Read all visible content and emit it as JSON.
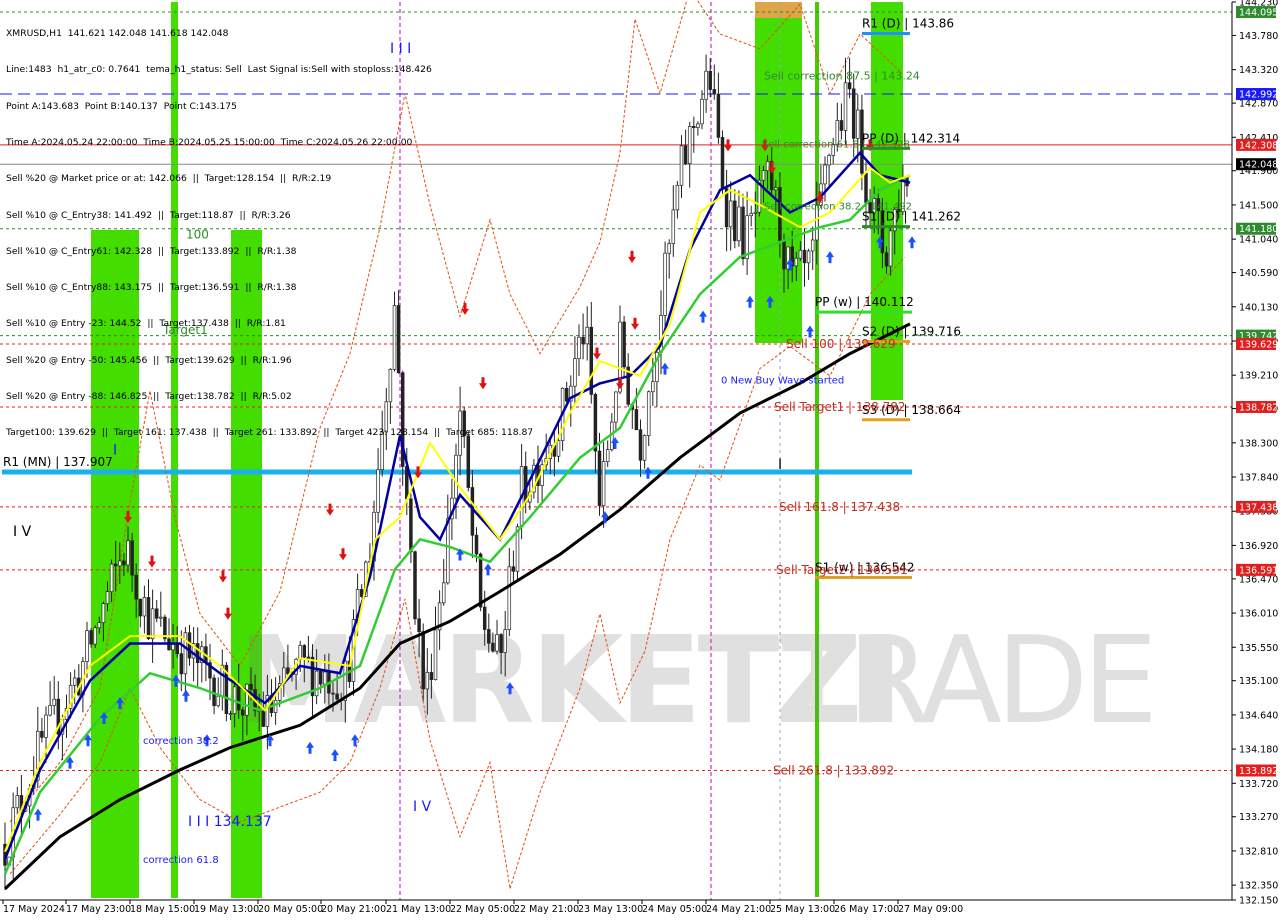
{
  "header": {
    "lines": [
      "XMRUSD,H1  141.621 142.048 141.618 142.048",
      "Line:1483  h1_atr_c0: 0.7641  tema_h1_status: Sell  Last Signal is:Sell with stoploss:148.426",
      "Point A:143.683  Point B:140.137  Point C:143.175",
      "Time A:2024.05.24 22:00:00  Time B:2024.05.25 15:00:00  Time C:2024.05.26 22:00:00",
      "Sell %20 @ Market price or at: 142.066  ||  Target:128.154  ||  R/R:2.19",
      "Sell %10 @ C_Entry38: 141.492  ||  Target:118.87  ||  R/R:3.26",
      "Sell %10 @ C_Entry61: 142.328  ||  Target:133.892  ||  R/R:1.38",
      "Sell %10 @ C_Entry88: 143.175  ||  Target:136.591  ||  R/R:1.38",
      "Sell %10 @ Entry -23: 144.52  ||  Target:137.438  ||  R/R:1.81",
      "Sell %20 @ Entry -50: 145.456  ||  Target:139.629  ||  R/R:1.96",
      "Sell %20 @ Entry -88: 146.825  ||  Target:138.782  ||  R/R:5.02",
      "Target100: 139.629  ||  Target 161: 137.438  ||  Target 261: 133.892  ||  Target 423: 128.154  ||  Target 685: 118.87"
    ]
  },
  "watermark": {
    "left": "MARKETZI",
    "right": "TRADE"
  },
  "chart_data": {
    "type": "candlestick",
    "symbol": "XMRUSD",
    "timeframe": "H1",
    "ylim": [
      132.15,
      144.23
    ],
    "y_ticks": [
      "144.230",
      "143.780",
      "143.320",
      "142.870",
      "142.410",
      "141.960",
      "141.500",
      "141.040",
      "140.590",
      "140.130",
      "139.670",
      "139.210",
      "138.760",
      "138.300",
      "137.840",
      "137.380",
      "136.920",
      "136.470",
      "136.010",
      "135.550",
      "135.100",
      "134.640",
      "134.180",
      "133.720",
      "133.270",
      "132.810",
      "132.350",
      "132.150"
    ],
    "x_labels": [
      "17 May 2024",
      "17 May 23:00",
      "18 May 15:00",
      "19 May 13:00",
      "20 May 05:00",
      "20 May 21:00",
      "21 May 13:00",
      "22 May 05:00",
      "22 May 21:00",
      "23 May 13:00",
      "24 May 05:00",
      "24 May 21:00",
      "25 May 13:00",
      "26 May 17:00",
      "27 May 09:00"
    ],
    "price_tags": [
      {
        "value": 144.095,
        "label": "144.095",
        "bg": "#2e8b2e"
      },
      {
        "value": 142.992,
        "label": "142.992",
        "bg": "#1a1aff"
      },
      {
        "value": 142.308,
        "label": "142.308",
        "bg": "#e02020"
      },
      {
        "value": 142.048,
        "label": "142.048",
        "bg": "#000000"
      },
      {
        "value": 141.18,
        "label": "141.180",
        "bg": "#2e8b2e"
      },
      {
        "value": 139.742,
        "label": "139.742",
        "bg": "#2e8b2e"
      },
      {
        "value": 139.629,
        "label": "139.629",
        "bg": "#e02020"
      },
      {
        "value": 138.782,
        "label": "138.782",
        "bg": "#e02020"
      },
      {
        "value": 137.438,
        "label": "137.438",
        "bg": "#e02020"
      },
      {
        "value": 136.591,
        "label": "136.591",
        "bg": "#e02020"
      },
      {
        "value": 133.892,
        "label": "133.892",
        "bg": "#e02020"
      }
    ],
    "hlines": [
      {
        "value": 144.095,
        "color": "#2e8b2e",
        "dash": "3,3"
      },
      {
        "value": 142.992,
        "color": "#1a1aff",
        "dash": "12,6"
      },
      {
        "value": 142.308,
        "color": "#e02020",
        "dash": ""
      },
      {
        "value": 142.048,
        "color": "#888888",
        "dash": ""
      },
      {
        "value": 141.18,
        "color": "#2e8b2e",
        "dash": "3,3"
      },
      {
        "value": 139.742,
        "color": "#2e8b2e",
        "dash": "3,3"
      },
      {
        "value": 139.629,
        "color": "#e02020",
        "dash": "3,3"
      },
      {
        "value": 138.782,
        "color": "#e02020",
        "dash": "3,3"
      },
      {
        "value": 137.438,
        "color": "#e02020",
        "dash": "3,3"
      },
      {
        "value": 136.591,
        "color": "#e02020",
        "dash": "3,3"
      },
      {
        "value": 133.892,
        "color": "#e02020",
        "dash": "3,3"
      }
    ],
    "pivots": [
      {
        "label": "R1 (D) | 143.86",
        "value": 143.86,
        "color": "#1e90ff"
      },
      {
        "label": "PP (D) | 142.314",
        "value": 142.314,
        "color": "#2e8b2e"
      },
      {
        "label": "S1 (D) | 141.262",
        "value": 141.262,
        "color": "#2e8b2e"
      },
      {
        "label": "PP (w) | 140.112",
        "value": 140.112,
        "color": "#2ee02e"
      },
      {
        "label": "S2 (D) | 139.716",
        "value": 139.716,
        "color": "#e0a020"
      },
      {
        "label": "S3 (D) | 138.664",
        "value": 138.664,
        "color": "#e0a020"
      },
      {
        "label": "S1 (w) | 136.542",
        "value": 136.542,
        "color": "#e0a020"
      },
      {
        "label": "R1 (MN) | 137.907",
        "value": 137.907,
        "color": "#1ab0f0"
      }
    ],
    "annotations": [
      {
        "text": "Sell correction 87.5 | 143.24",
        "color": "#2e8b2e"
      },
      {
        "text": "Sell correction 61.8 | 142.328",
        "color": "#2e8b2e"
      },
      {
        "text": "Sell correction 38.2 | 141.492",
        "color": "#2e8b2e"
      },
      {
        "text": "Sell 100 | 139.629",
        "color": "#c03020"
      },
      {
        "text": "Sell Target1 | 138.782",
        "color": "#c03020"
      },
      {
        "text": "Sell 161.8 | 137.438",
        "color": "#c03020"
      },
      {
        "text": "Sell Target2 | 136.591",
        "color": "#c03020"
      },
      {
        "text": "Sell 261.8 | 133.892",
        "color": "#c03020"
      },
      {
        "text": "0 New Buy Wave started",
        "color": "#1a1aff"
      },
      {
        "text": "correction 38.2",
        "color": "#1a1aff"
      },
      {
        "text": "correction 61.8",
        "color": "#1a1aff"
      },
      {
        "text": "I I I 134.137",
        "color": "#1a1aff"
      },
      {
        "text": "Target1",
        "color": "#2e8b2e"
      },
      {
        "text": "100",
        "color": "#2e8b2e"
      },
      {
        "text": "I V",
        "color": "#000000"
      },
      {
        "text": "I V",
        "color": "#1a1aff"
      },
      {
        "text": "I I I",
        "color": "#1a1aff"
      },
      {
        "text": "I",
        "color": "#1a1aff"
      },
      {
        "text": "I",
        "color": "#000000"
      }
    ],
    "colors": {
      "bull": "#1a1a1a",
      "bear": "#1a1a1a",
      "ma_blue": "#0000a0",
      "ma_yellow": "#ffff00",
      "ma_green": "#33cc33",
      "ma_black": "#000000",
      "band": "#44dd00",
      "band_orange": "#f0a050"
    }
  }
}
